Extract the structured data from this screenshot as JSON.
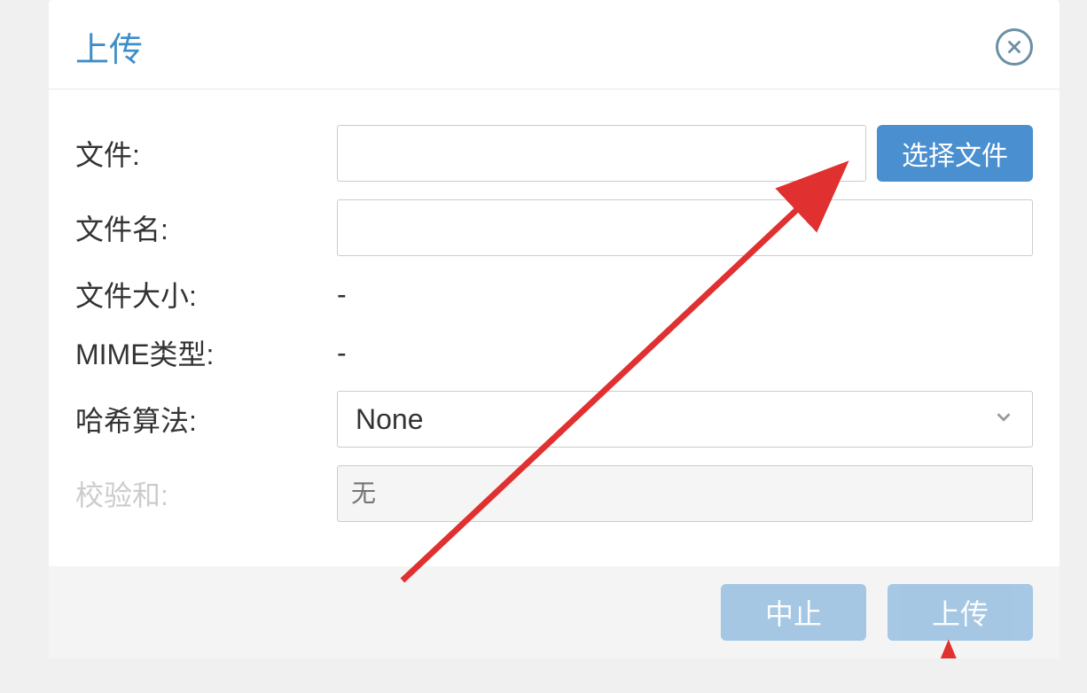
{
  "dialog": {
    "title": "上传",
    "close_aria": "关闭"
  },
  "form": {
    "file_label": "文件:",
    "file_value": "",
    "select_file_button": "选择文件",
    "filename_label": "文件名:",
    "filename_value": "",
    "filesize_label": "文件大小:",
    "filesize_value": "-",
    "mimetype_label": "MIME类型:",
    "mimetype_value": "-",
    "hash_label": "哈希算法:",
    "hash_selected": "None",
    "checksum_label": "校验和:",
    "checksum_placeholder": "无"
  },
  "footer": {
    "abort_button": "中止",
    "upload_button": "上传"
  }
}
